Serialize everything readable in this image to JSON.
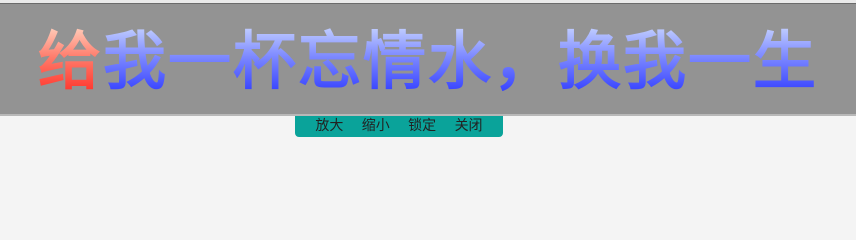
{
  "lyric": {
    "sung": "给",
    "unsung": "我一杯忘情水，换我一生"
  },
  "toolbar": {
    "zoom_in_label": "放大",
    "zoom_out_label": "缩小",
    "lock_label": "锁定",
    "close_label": "关闭"
  },
  "colors": {
    "lyric_bar_bg": "#939393",
    "toolbar_bg": "#0aa39a",
    "sung_color": "#ff3b2f",
    "unsung_color": "#3b46ff"
  }
}
